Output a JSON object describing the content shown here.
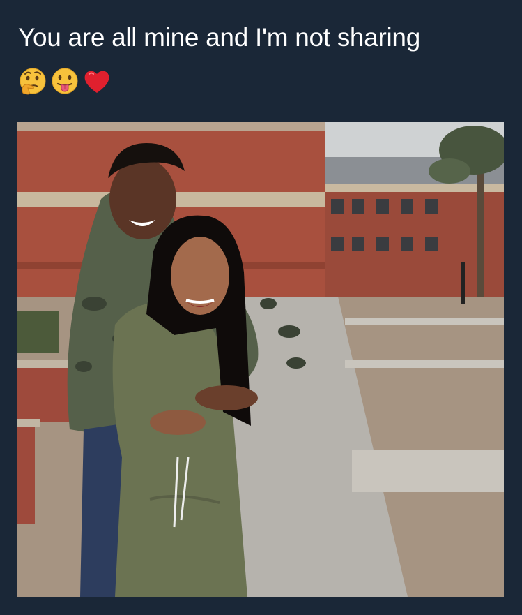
{
  "tweet": {
    "text": "You are all mine and I'm not sharing",
    "emojis": [
      "thinking-face",
      "face-with-tongue",
      "red-heart"
    ]
  },
  "photo": {
    "subject": "photo"
  },
  "colors": {
    "background": "#1a2737",
    "text": "#ffffff"
  }
}
